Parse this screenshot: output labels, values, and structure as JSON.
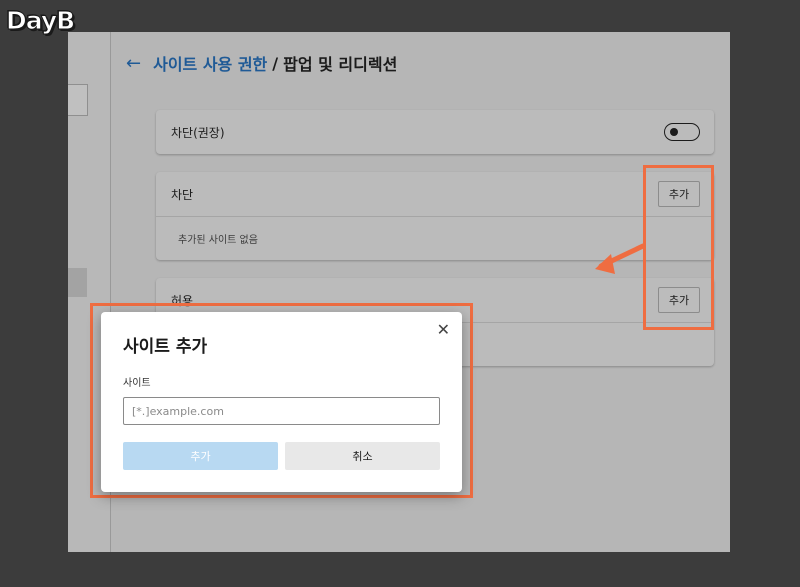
{
  "logo": "DayB",
  "header": {
    "back_icon": "arrow-left-icon",
    "back_arrow": "←",
    "breadcrumb_parent": "사이트 사용 권한",
    "separator": "/",
    "breadcrumb_current": "팝업 및 리디렉션"
  },
  "blocked_recommended": {
    "label": "차단(권장)",
    "toggle_state": "off"
  },
  "block_section": {
    "title": "차단",
    "add_label": "추가",
    "empty_text": "추가된 사이트 없음"
  },
  "allow_section": {
    "title": "허용",
    "add_label": "추가"
  },
  "dialog": {
    "title": "사이트 추가",
    "close_glyph": "✕",
    "close_icon": "close-icon",
    "field_label": "사이트",
    "input_value": "",
    "input_placeholder": "[*.]example.com",
    "confirm_label": "추가",
    "cancel_label": "취소"
  },
  "colors": {
    "annotation": "#ef6d41",
    "link": "#1f5a96",
    "primary_button_disabled": "#b8d9f2"
  }
}
